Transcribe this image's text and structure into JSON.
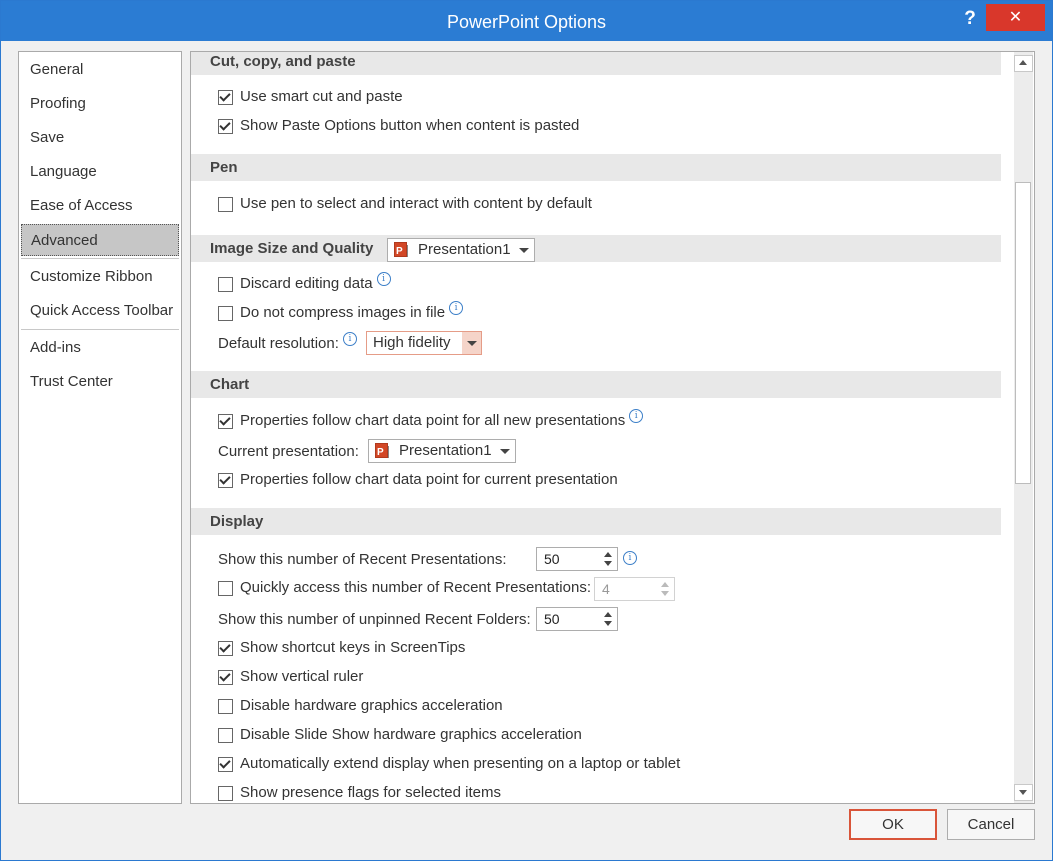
{
  "window": {
    "title": "PowerPoint Options",
    "help": "?",
    "close": "✕"
  },
  "nav": {
    "items": [
      "General",
      "Proofing",
      "Save",
      "Language",
      "Ease of Access",
      "Advanced",
      "Customize Ribbon",
      "Quick Access Toolbar",
      "Add-ins",
      "Trust Center"
    ],
    "selected": "Advanced"
  },
  "sections": {
    "cut": {
      "title": "Cut, copy, and paste",
      "smart_cut": {
        "label": "Use smart cut and paste",
        "checked": true
      },
      "paste_options": {
        "label": "Show Paste Options button when content is pasted",
        "checked": true
      }
    },
    "pen": {
      "title": "Pen",
      "use_pen": {
        "label": "Use pen to select and interact with content by default",
        "checked": false
      }
    },
    "image": {
      "title": "Image Size and Quality",
      "presentation": "Presentation1",
      "discard": {
        "label": "Discard editing data",
        "checked": false
      },
      "no_compress": {
        "label": "Do not compress images in file",
        "checked": false
      },
      "resolution_label": "Default resolution:",
      "resolution_value": "High fidelity"
    },
    "chart": {
      "title": "Chart",
      "props_all": {
        "label": "Properties follow chart data point for all new presentations",
        "checked": true
      },
      "current_label": "Current presentation:",
      "current_value": "Presentation1",
      "props_current": {
        "label": "Properties follow chart data point for current presentation",
        "checked": true
      }
    },
    "display": {
      "title": "Display",
      "recent_label": "Show this number of Recent Presentations:",
      "recent_value": "50",
      "quick_access": {
        "label": "Quickly access this number of Recent Presentations:",
        "checked": false,
        "value": "4"
      },
      "folders_label": "Show this number of unpinned Recent Folders:",
      "folders_value": "50",
      "shortcut_keys": {
        "label": "Show shortcut keys in ScreenTips",
        "checked": true
      },
      "vertical_ruler": {
        "label": "Show vertical ruler",
        "checked": true
      },
      "disable_hw": {
        "label": "Disable hardware graphics acceleration",
        "checked": false
      },
      "disable_slideshow_hw": {
        "label": "Disable Slide Show hardware graphics acceleration",
        "checked": false
      },
      "auto_extend": {
        "label": "Automatically extend display when presenting on a laptop or tablet",
        "checked": true
      },
      "presence_flags": {
        "label": "Show presence flags for selected items",
        "checked": false
      }
    }
  },
  "buttons": {
    "ok": "OK",
    "cancel": "Cancel"
  }
}
